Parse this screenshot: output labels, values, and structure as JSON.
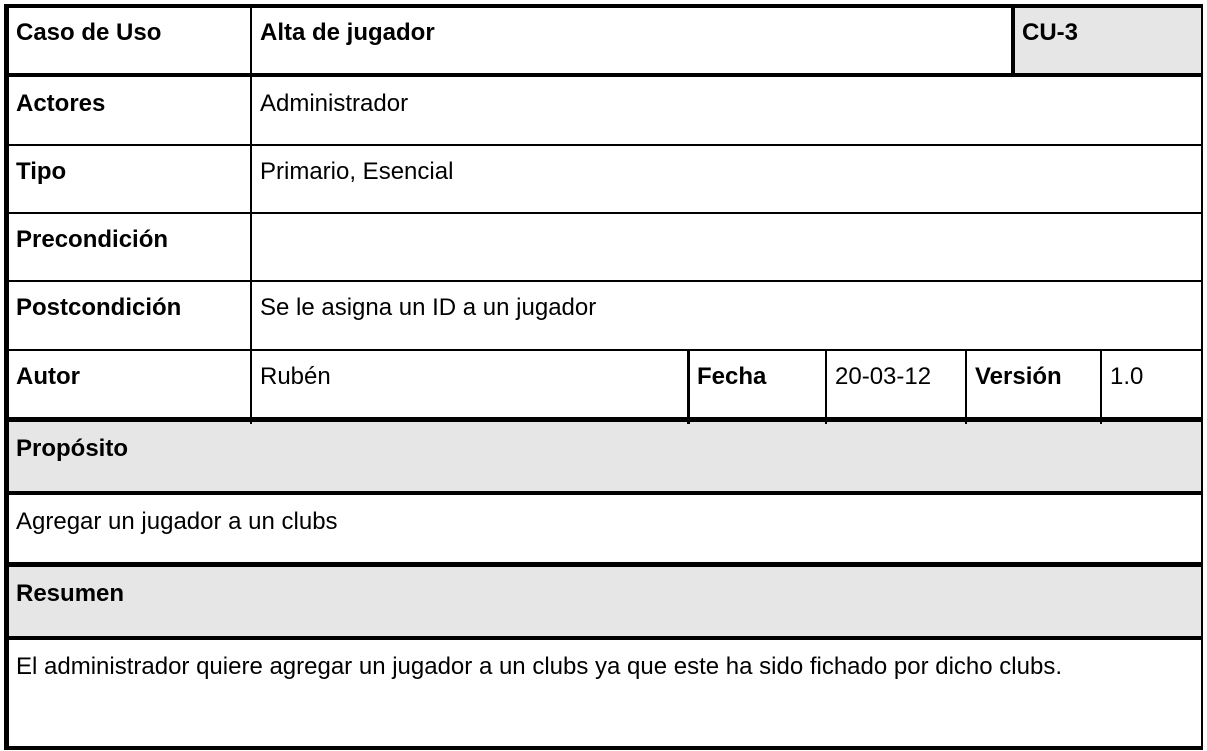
{
  "header": {
    "label": "Caso de Uso",
    "title": "Alta de jugador",
    "code": "CU-3"
  },
  "actores": {
    "label": "Actores",
    "value": "Administrador"
  },
  "tipo": {
    "label": "Tipo",
    "value": "Primario, Esencial"
  },
  "precondicion": {
    "label": "Precondición",
    "value": ""
  },
  "postcondicion": {
    "label": "Postcondición",
    "value": "Se le asigna un ID a un jugador"
  },
  "meta": {
    "autor_label": "Autor",
    "autor_value": "Rubén",
    "fecha_label": "Fecha",
    "fecha_value": "20-03-12",
    "version_label": "Versión",
    "version_value": "1.0"
  },
  "proposito": {
    "label": "Propósito",
    "text": "Agregar un jugador a un clubs"
  },
  "resumen": {
    "label": "Resumen",
    "text": "El administrador quiere agregar un jugador a un clubs ya que este ha sido fichado por dicho clubs."
  },
  "colors": {
    "header_gray": "#e6e6e6",
    "border": "#000000"
  }
}
